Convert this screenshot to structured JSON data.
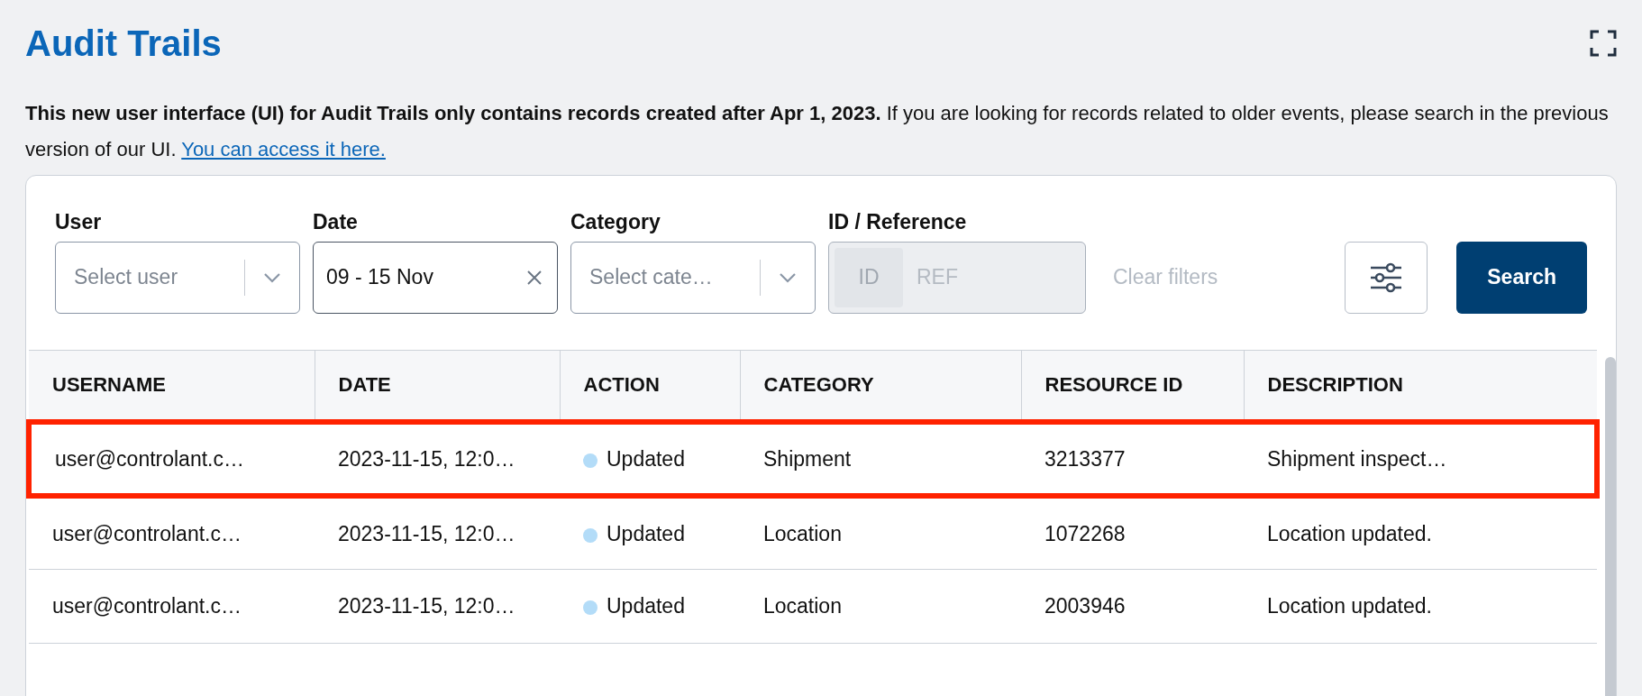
{
  "header": {
    "title": "Audit Trails"
  },
  "notice": {
    "text": "**This new user interface (UI) for Audit Trails only contains records created after Apr 1, 2023.** If you are looking for records related to older events, please search in the previous version of our UI.",
    "link": "You can access it here."
  },
  "filters": {
    "user": {
      "label": "User",
      "placeholder": "Select user"
    },
    "date": {
      "label": "Date",
      "value": "09 - 15 Nov"
    },
    "category": {
      "label": "Category",
      "placeholder": "Select cate…"
    },
    "id_reference": {
      "label": "ID / Reference",
      "disabled": true,
      "options": [
        {
          "label": "ID",
          "selected": true
        },
        {
          "label": "REF",
          "selected": false
        }
      ]
    },
    "clear": {
      "label": "Clear filters",
      "disabled": true
    },
    "search": {
      "label": "Search"
    }
  },
  "table": {
    "columns": [
      "USERNAME",
      "DATE",
      "ACTION",
      "CATEGORY",
      "RESOURCE ID",
      "DESCRIPTION"
    ],
    "rows": [
      {
        "highlighted": true,
        "cells": [
          "user@controlant.c…",
          "2023-11-15, 12:0…",
          "Updated",
          "Shipment",
          "3213377",
          "Shipment inspect…"
        ]
      },
      {
        "highlighted": false,
        "cells": [
          "user@controlant.c…",
          "2023-11-15, 12:0…",
          "Updated",
          "Location",
          "1072268",
          "Location updated."
        ]
      },
      {
        "highlighted": false,
        "cells": [
          "user@controlant.c…",
          "2023-11-15, 12:0…",
          "Updated",
          "Location",
          "2003946",
          "Location updated."
        ]
      }
    ]
  }
}
